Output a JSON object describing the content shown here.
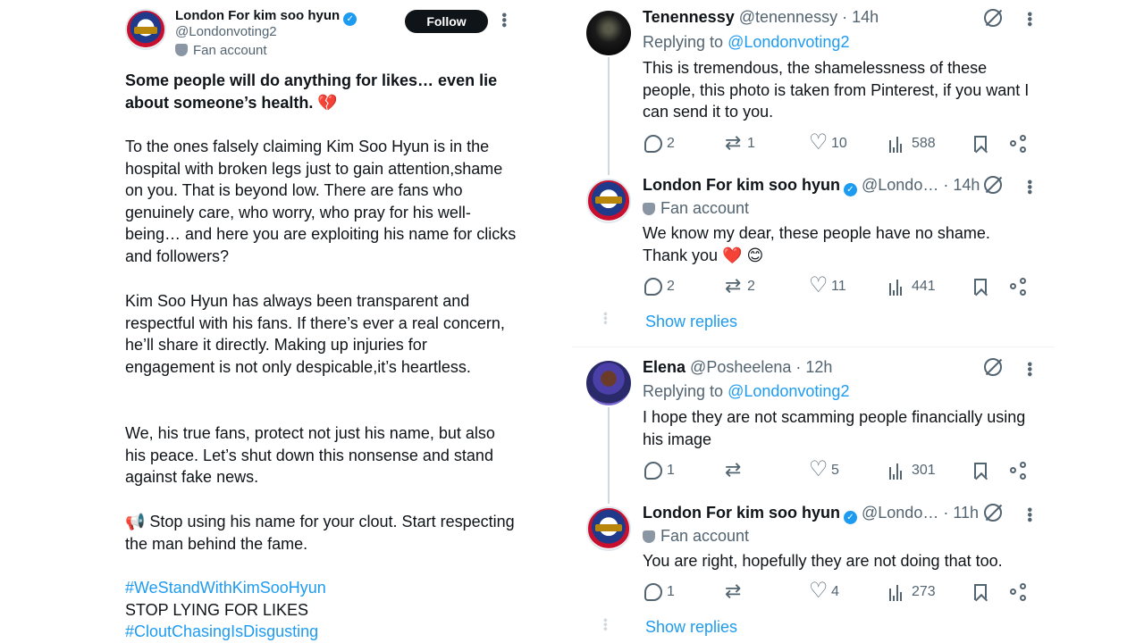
{
  "left_tweet": {
    "author_name": "London For kim soo hyun",
    "author_handle": "@Londonvoting2",
    "fan_label": "Fan account",
    "follow_label": "Follow",
    "verified_glyph": "✓",
    "paragraphs": [
      "Some people will do anything for likes… even lie about someone’s health. 💔",
      "To the ones falsely claiming Kim Soo Hyun is in the hospital with broken legs just to gain attention,shame on you. That is beyond low. There are fans who genuinely care, who worry, who pray for his well-being… and here you are exploiting his name for clicks and followers?",
      "Kim Soo Hyun has always been transparent and respectful with his fans. If there’s ever a real concern, he’ll share it directly. Making up injuries for engagement is not only despicable,it’s heartless.",
      "We, his true fans, protect not just his name, but also his peace. Let’s shut down this nonsense and stand against fake news.",
      "📢 Stop using his name for your clout. Start respecting the man behind the fame."
    ],
    "hashtag1": "#WeStandWithKimSooHyun",
    "shout": "STOP LYING FOR LIKES",
    "hashtag2": "#CloutChasingIsDisgusting"
  },
  "replies": [
    {
      "name": "Tenennessy",
      "meta": "@tenennessy · 14h",
      "replying_prefix": "Replying to",
      "replying_to": "@Londonvoting2",
      "text": "This is tremendous, the shamelessness of these people, this photo is taken from Pinterest, if you want I can send it to you.",
      "replies": "2",
      "retweets": "1",
      "likes": "10",
      "views": "588"
    },
    {
      "name": "London For kim soo hyun",
      "meta": "@Londo… · 14h",
      "fan_label": "Fan account",
      "text": "We know my dear, these people have no shame. Thank you ❤️ 😊",
      "replies": "2",
      "retweets": "2",
      "likes": "11",
      "views": "441",
      "show_replies": "Show replies"
    },
    {
      "name": "Elena",
      "meta": "@Posheelena · 12h",
      "replying_prefix": "Replying to",
      "replying_to": "@Londonvoting2",
      "text": "I hope they are not scamming people financially using his image",
      "replies": "1",
      "retweets": "",
      "likes": "5",
      "views": "301"
    },
    {
      "name": "London For kim soo hyun",
      "meta": "@Londo… · 11h",
      "fan_label": "Fan account",
      "text": "You are right, hopefully they are not doing that too.",
      "replies": "1",
      "retweets": "",
      "likes": "4",
      "views": "273",
      "show_replies": "Show replies"
    }
  ],
  "colors": {
    "accent": "#1d9bf0",
    "muted": "#536471",
    "text": "#0f1419"
  }
}
